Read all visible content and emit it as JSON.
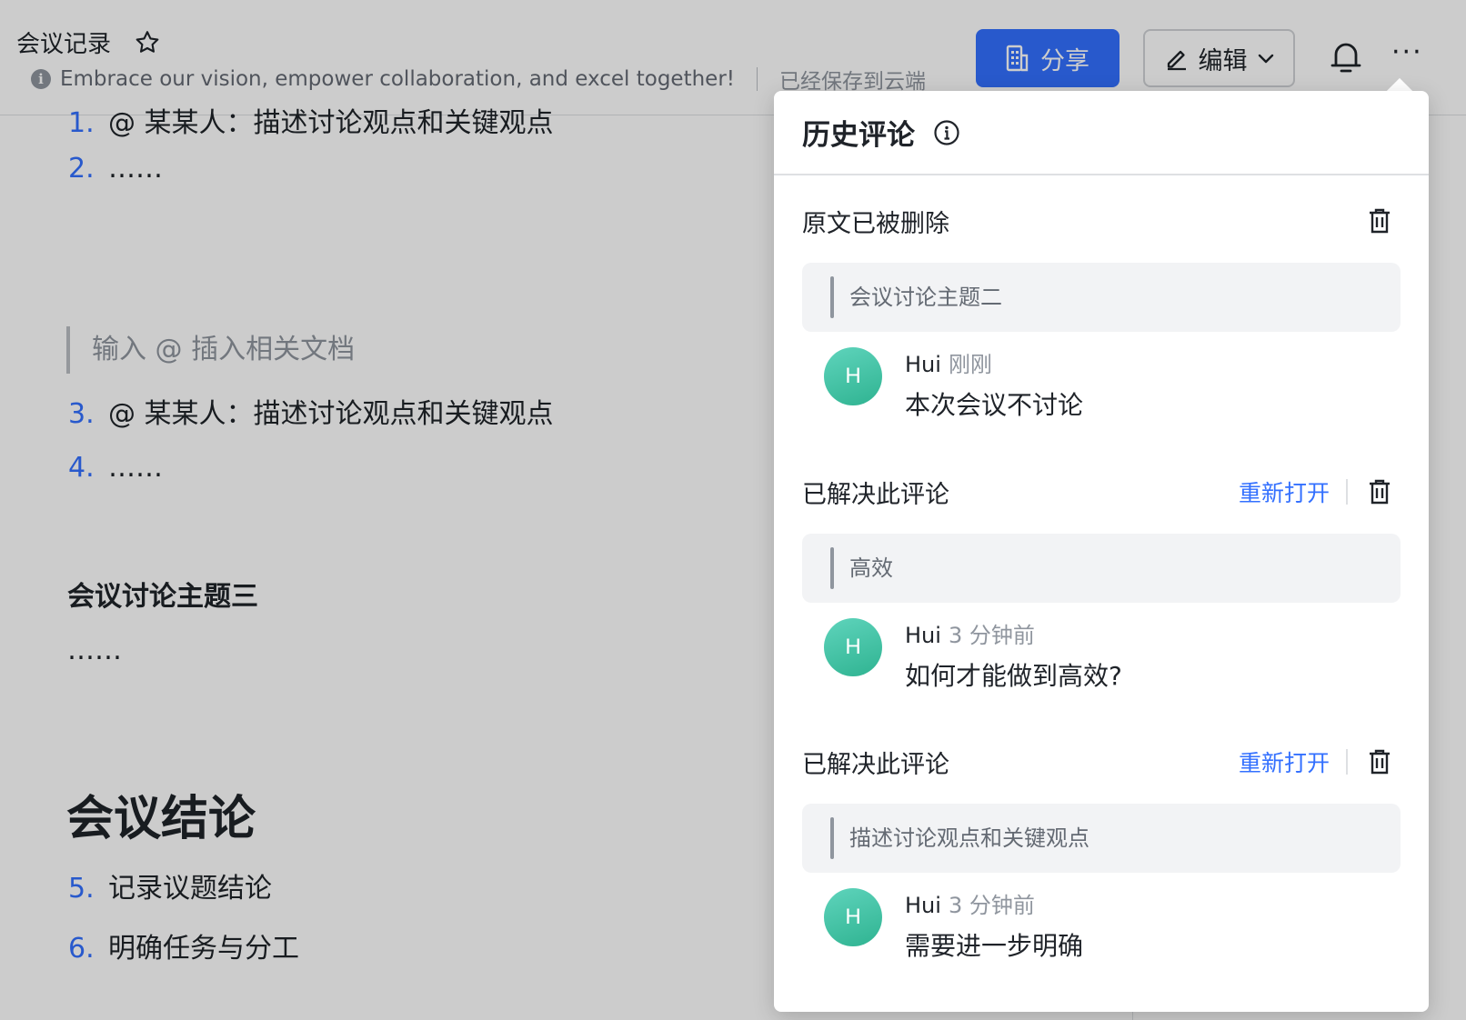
{
  "header": {
    "doc_title": "会议记录",
    "slogan": "Embrace our vision, empower collaboration, and excel together!",
    "save_status": "已经保存到云端",
    "share_label": "分享",
    "edit_label": "编辑",
    "more_label": "···"
  },
  "doc": {
    "items": [
      {
        "num": "1.",
        "text": "@ 某某人：描述讨论观点和关键观点"
      },
      {
        "num": "2.",
        "text": "……"
      },
      {
        "num": "3.",
        "text": "@ 某某人：描述讨论观点和关键观点"
      },
      {
        "num": "4.",
        "text": "……"
      },
      {
        "num": "5.",
        "text": "记录议题结论"
      },
      {
        "num": "6.",
        "text": "明确任务与分工"
      }
    ],
    "quote_placeholder": "输入 @ 插入相关文档",
    "topic3_heading": "会议讨论主题三",
    "topic3_body": "……",
    "conclusion_heading": "会议结论"
  },
  "panel": {
    "title": "历史评论",
    "threads": [
      {
        "status": "原文已被删除",
        "reopen_label": "",
        "quote": "会议讨论主题二",
        "author_initial": "H",
        "author": "Hui",
        "time": "刚刚",
        "text": "本次会议不讨论"
      },
      {
        "status": "已解决此评论",
        "reopen_label": "重新打开",
        "quote": "高效",
        "author_initial": "H",
        "author": "Hui",
        "time": "3 分钟前",
        "text": "如何才能做到高效?"
      },
      {
        "status": "已解决此评论",
        "reopen_label": "重新打开",
        "quote": "描述讨论观点和关键观点",
        "author_initial": "H",
        "author": "Hui",
        "time": "3 分钟前",
        "text": "需要进一步明确"
      }
    ]
  },
  "colors": {
    "accent": "#3370ff",
    "avatar": "#2fb391",
    "mask": "rgba(0,0,0,0.2)"
  }
}
